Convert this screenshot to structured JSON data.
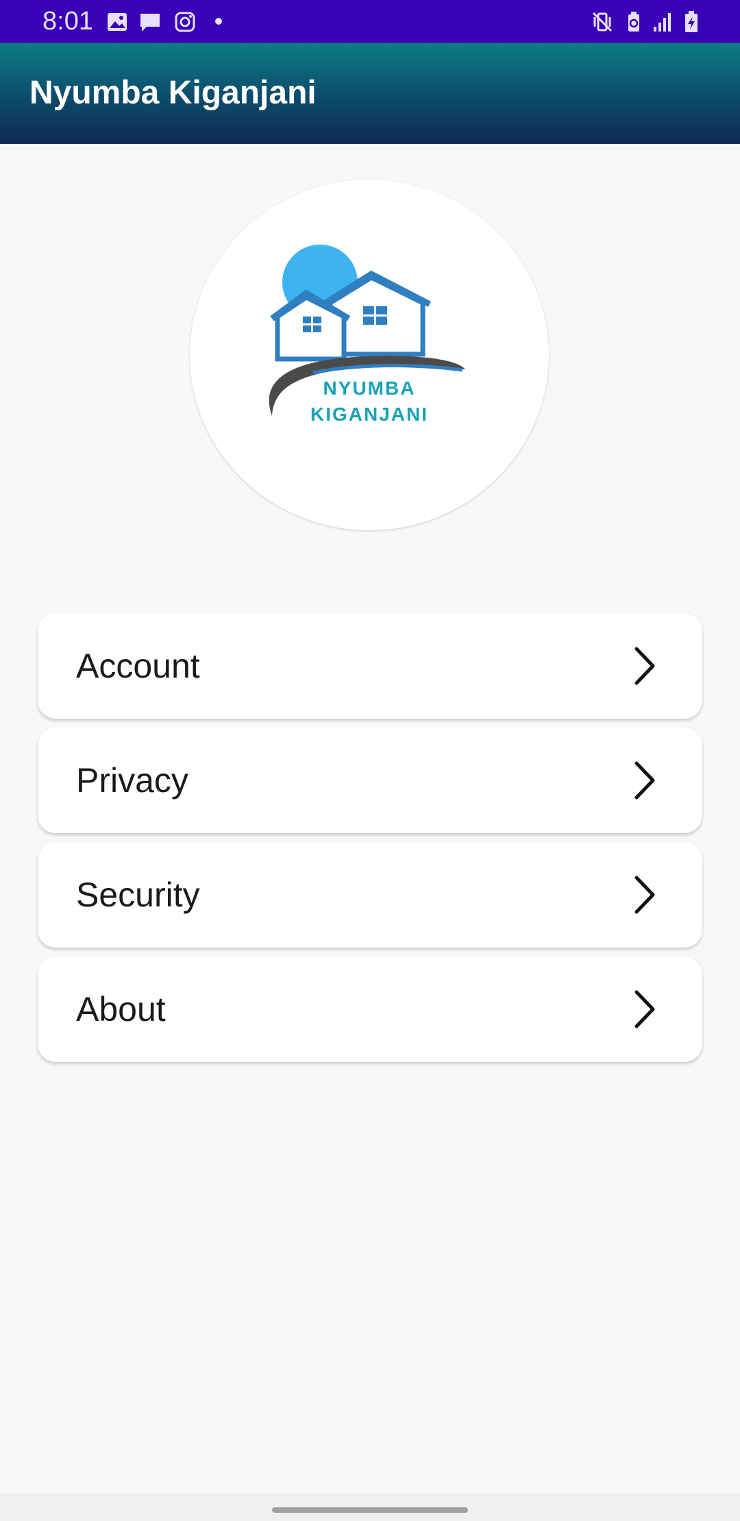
{
  "status_bar": {
    "time": "8:01",
    "left_icons": [
      "gallery-icon",
      "message-icon",
      "instagram-icon",
      "notification-dot"
    ],
    "right_icons": [
      "vibrate-mute-icon",
      "battery-saver-icon",
      "signal-icon",
      "battery-charging-icon"
    ],
    "background_color": "#3900b8"
  },
  "app_bar": {
    "title": "Nyumba Kiganjani",
    "gradient_colors": [
      "#0b7d86",
      "#0f2a55"
    ]
  },
  "logo": {
    "line1": "NYUMBA",
    "line2": "KIGANJANI",
    "colors": {
      "sun": "#3db3f2",
      "house": "#2f7fc1",
      "road": "#4a4a4a",
      "text": "#16a3b8"
    }
  },
  "menu": {
    "items": [
      {
        "label": "Account",
        "icon": "chevron-right-icon"
      },
      {
        "label": "Privacy",
        "icon": "chevron-right-icon"
      },
      {
        "label": "Security",
        "icon": "chevron-right-icon"
      },
      {
        "label": "About",
        "icon": "chevron-right-icon"
      }
    ]
  }
}
